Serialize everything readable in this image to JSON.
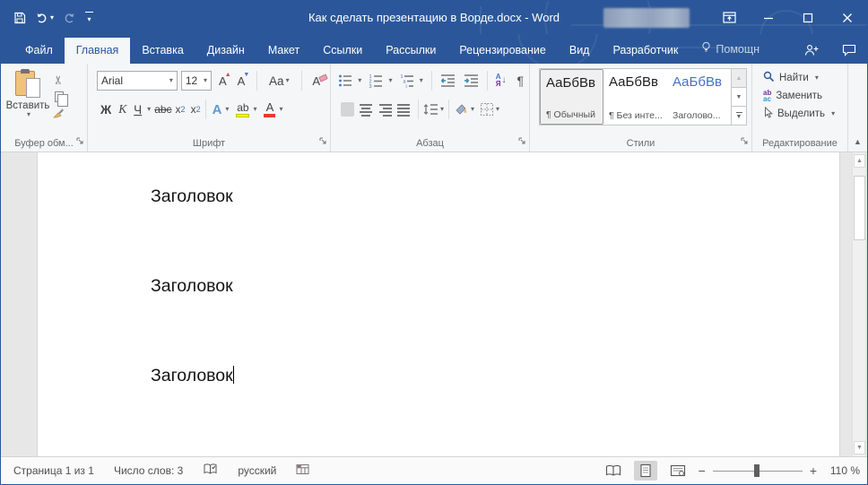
{
  "colors": {
    "accent": "#2b579a",
    "ribbon_bg": "#f5f6f7",
    "doc_bg": "#e7e7e7",
    "highlight_yellow": "#ffff00",
    "font_color_red": "#e03c31",
    "heading_blue": "#4472c4"
  },
  "titlebar": {
    "title": "Как сделать презентацию в Ворде.docx - Word"
  },
  "tabs": {
    "items": [
      {
        "label": "Файл"
      },
      {
        "label": "Главная"
      },
      {
        "label": "Вставка"
      },
      {
        "label": "Дизайн"
      },
      {
        "label": "Макет"
      },
      {
        "label": "Ссылки"
      },
      {
        "label": "Рассылки"
      },
      {
        "label": "Рецензирование"
      },
      {
        "label": "Вид"
      },
      {
        "label": "Разработчик"
      },
      {
        "label": "Помощн"
      }
    ]
  },
  "ribbon": {
    "clipboard": {
      "paste_label": "Вставить",
      "group_label": "Буфер обм..."
    },
    "font": {
      "family": "Arial",
      "size": "12",
      "bold": "Ж",
      "italic": "К",
      "underline": "Ч",
      "strikethrough": "abc",
      "subscript_base": "x",
      "subscript_mark": "2",
      "superscript_base": "x",
      "superscript_mark": "2",
      "grow": "A",
      "shrink": "A",
      "change_case": "Aa",
      "clear_format": "А",
      "text_effects": "А",
      "highlight": "ab",
      "font_color": "А",
      "group_label": "Шрифт"
    },
    "paragraph": {
      "sort_a": "А",
      "sort_b": "Я",
      "pilcrow": "¶",
      "group_label": "Абзац"
    },
    "styles": {
      "preview": "АаБбВв",
      "items": [
        {
          "name": "¶ Обычный"
        },
        {
          "name": "¶ Без инте..."
        },
        {
          "name": "Заголово..."
        }
      ],
      "group_label": "Стили"
    },
    "editing": {
      "find": "Найти",
      "replace": "Заменить",
      "select": "Выделить",
      "group_label": "Редактирование"
    }
  },
  "document": {
    "paragraphs": [
      "Заголовок",
      "Заголовок",
      "Заголовок"
    ]
  },
  "statusbar": {
    "page_info": "Страница 1 из 1",
    "word_count": "Число слов: 3",
    "language": "русский",
    "zoom_level": "110 %"
  }
}
